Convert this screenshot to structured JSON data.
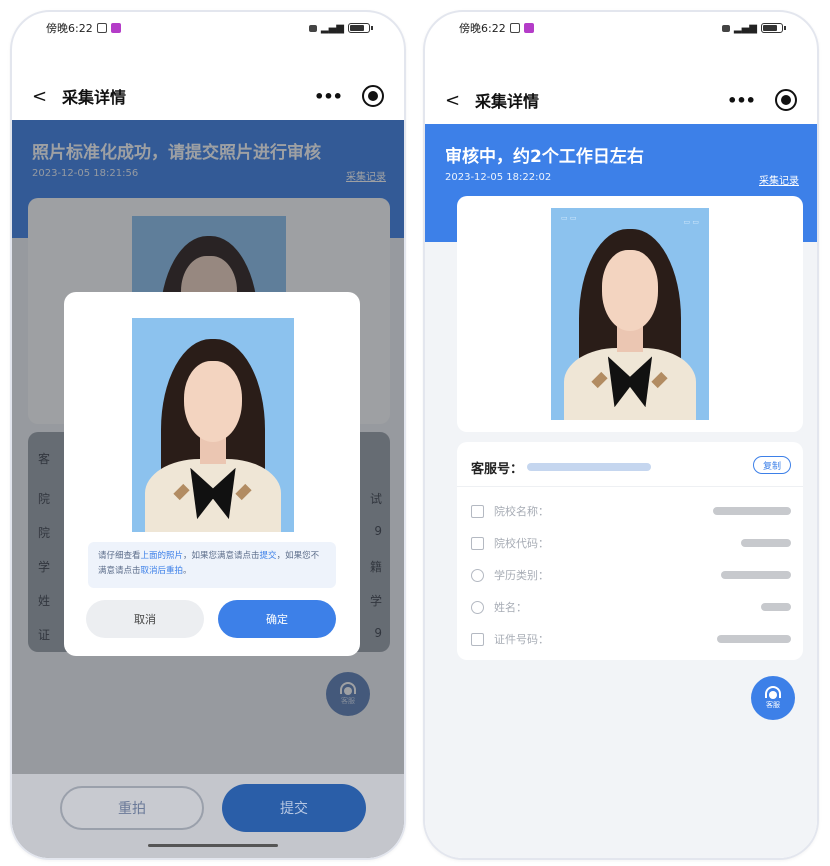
{
  "left_phone": {
    "status": {
      "time": "傍晚6:22"
    },
    "nav": {
      "back": "<",
      "title": "采集详情",
      "more": "•••"
    },
    "banner": {
      "headline": "照片标准化成功，请提交照片进行审核",
      "timestamp": "2023-12-05 18:21:56",
      "record_link": "采集记录"
    },
    "dim_labels": [
      "客",
      "院",
      "院",
      "学",
      "姓",
      "证"
    ],
    "dim_values": [
      "试",
      "9",
      "籍",
      "学",
      "9"
    ],
    "modal": {
      "note_prefix": "请仔细查看",
      "note_highlight1": "上面的照片",
      "note_mid": "，如果您满意请点击",
      "note_highlight2": "提交",
      "note_mid2": "，如果您不满意请点击",
      "note_highlight3": "取消后重拍",
      "note_end": "。",
      "cancel": "取消",
      "confirm": "确定"
    },
    "customer_service": "客服",
    "bottom": {
      "retake": "重拍",
      "submit": "提交"
    }
  },
  "right_phone": {
    "status": {
      "time": "傍晚6:22"
    },
    "nav": {
      "back": "<",
      "title": "采集详情",
      "more": "•••"
    },
    "banner": {
      "headline": "审核中，约2个工作日左右",
      "timestamp": "2023-12-05 18:22:02",
      "record_link": "采集记录"
    },
    "info": {
      "service_label": "客服号：",
      "copy": "复制",
      "rows": [
        {
          "label": "院校名称："
        },
        {
          "label": "院校代码："
        },
        {
          "label": "学历类别："
        },
        {
          "label": "姓名："
        },
        {
          "label": "证件号码："
        }
      ]
    },
    "customer_service": "客服"
  },
  "colors": {
    "accent": "#3d80e8",
    "photo_bg": "#8cc2ee",
    "page_bg": "#f2f4f7"
  }
}
